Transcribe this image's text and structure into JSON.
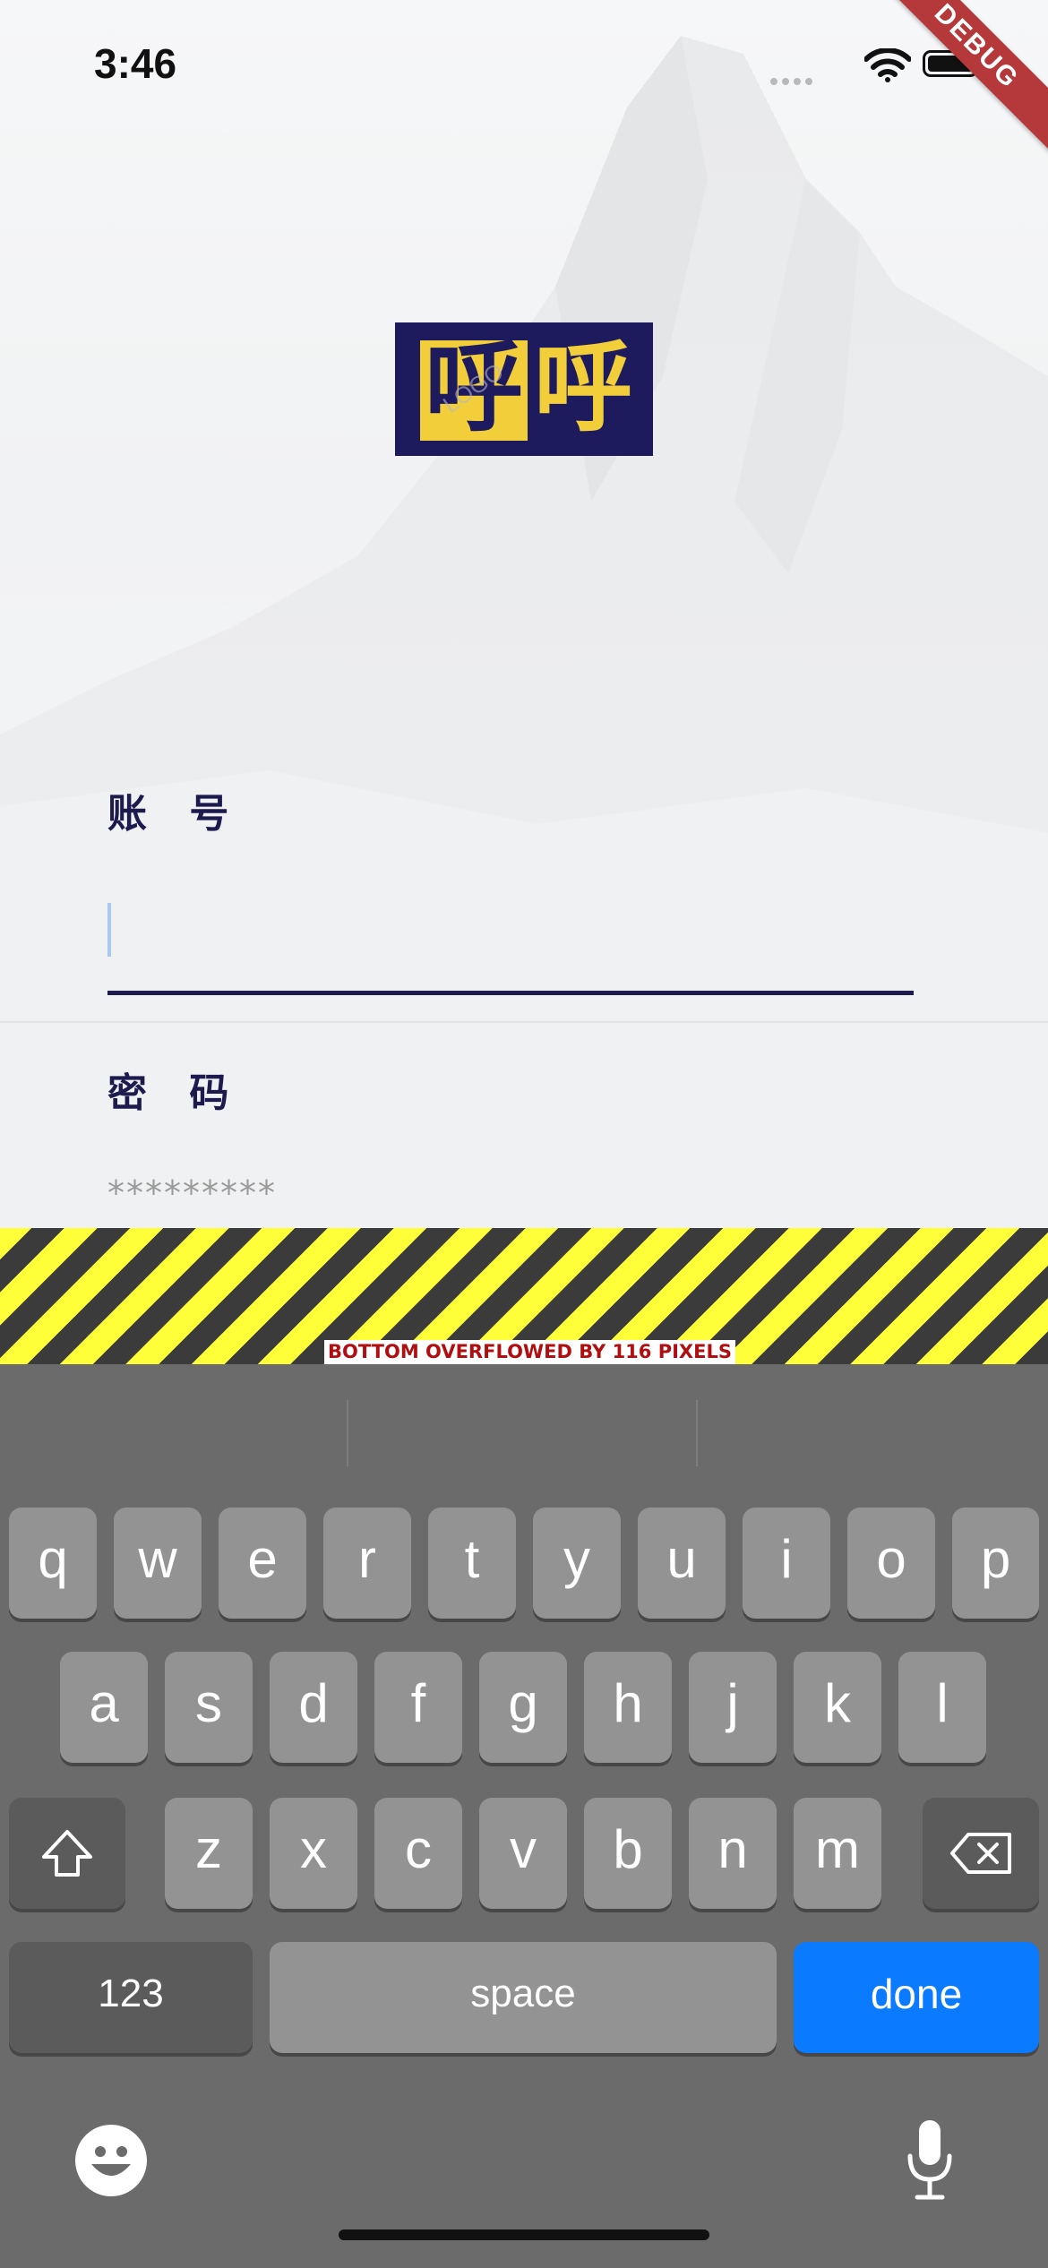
{
  "status_bar": {
    "time": "3:46",
    "signal_icon": "cellular-dots-icon",
    "wifi_icon": "wifi-icon",
    "battery_icon": "battery-full-icon"
  },
  "debug_banner": {
    "label": "DEBUG",
    "color": "#b5393a"
  },
  "logo": {
    "char_left": "呼",
    "char_right": "呼",
    "watermark": "LOGO",
    "colors": {
      "navy": "#1d1a5e",
      "yellow": "#f2cf3a"
    }
  },
  "form": {
    "account": {
      "label": "账 号",
      "value": ""
    },
    "password": {
      "label": "密 码",
      "placeholder": "*********"
    }
  },
  "overflow_warning": {
    "text": "BOTTOM OVERFLOWED BY 116 PIXELS"
  },
  "keyboard": {
    "row1": [
      "q",
      "w",
      "e",
      "r",
      "t",
      "y",
      "u",
      "i",
      "o",
      "p"
    ],
    "row2": [
      "a",
      "s",
      "d",
      "f",
      "g",
      "h",
      "j",
      "k",
      "l"
    ],
    "row3": [
      "z",
      "x",
      "c",
      "v",
      "b",
      "n",
      "m"
    ],
    "numbers_label": "123",
    "space_label": "space",
    "done_label": "done",
    "shift_icon": "shift-icon",
    "delete_icon": "delete-backspace-icon",
    "emoji_icon": "emoji-icon",
    "mic_icon": "microphone-icon",
    "accent_color": "#0a7aff"
  }
}
